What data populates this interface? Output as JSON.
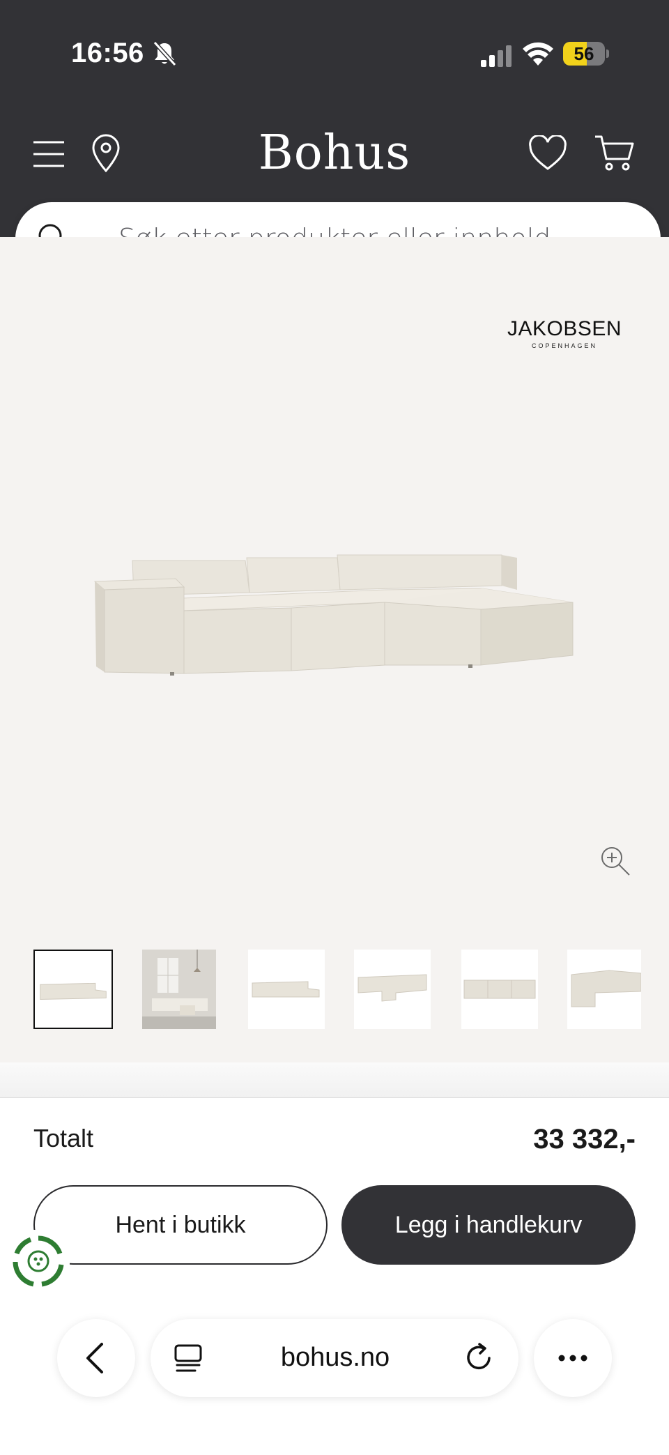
{
  "status_bar": {
    "time": "16:56",
    "battery": "56",
    "battery_level": 0.56,
    "icons": [
      "bell-slash-icon",
      "signal-icon",
      "wifi-icon",
      "battery-icon"
    ]
  },
  "header": {
    "logo": "Bohus",
    "icons": [
      "menu-icon",
      "location-pin-icon",
      "heart-icon",
      "cart-icon"
    ]
  },
  "search": {
    "placeholder": "Søk etter produkter eller innhold ..."
  },
  "product": {
    "brand": "JAKOBSEN",
    "brand_sub": "COPENHAGEN",
    "thumbnails_count": 6,
    "selected_thumbnail": 1
  },
  "purchase": {
    "total_label": "Totalt",
    "total_value": "33 332,-",
    "pickup_label": "Hent i butikk",
    "cart_label": "Legg i handlekurv"
  },
  "browser": {
    "url": "bohus.no"
  },
  "colors": {
    "header_bg": "#323236",
    "product_bg": "#f5f3f1",
    "primary_button": "#323236",
    "battery_yellow": "#f2d21b",
    "eco_green": "#2e7d32"
  }
}
